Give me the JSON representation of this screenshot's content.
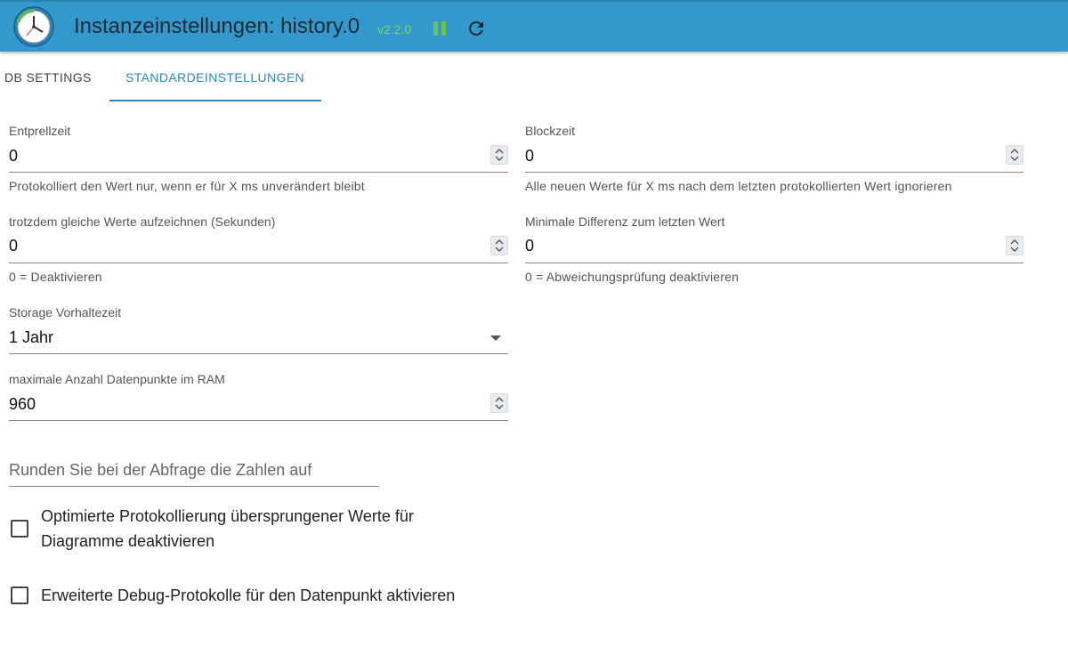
{
  "header": {
    "title": "Instanzeinstellungen: history.0",
    "version": "v2.2.0",
    "logo_icon": "history-clock-icon",
    "pause_icon": "pause-icon",
    "refresh_icon": "refresh-icon",
    "bg_color": "#3399cc"
  },
  "tabs": [
    {
      "label": "DB SETTINGS",
      "active": false
    },
    {
      "label": "STANDARDEINSTELLUNGEN",
      "active": true
    }
  ],
  "fields": {
    "entprellzeit": {
      "label": "Entprellzeit",
      "value": "0",
      "helper": "Protokolliert den Wert nur, wenn er für X ms unverändert bleibt"
    },
    "blockzeit": {
      "label": "Blockzeit",
      "value": "0",
      "helper": "Alle neuen Werte für X ms nach dem letzten protokollierten Wert ignorieren"
    },
    "gleiche_werte": {
      "label": "trotzdem gleiche Werte aufzeichnen (Sekunden)",
      "value": "0",
      "helper": "0 = Deaktivieren"
    },
    "min_differenz": {
      "label": "Minimale Differenz zum letzten Wert",
      "value": "0",
      "helper": "0 = Abweichungsprüfung deaktivieren"
    },
    "storage": {
      "label": "Storage Vorhaltezeit",
      "value": "1 Jahr"
    },
    "max_datenpunkte": {
      "label": "maximale Anzahl Datenpunkte im RAM",
      "value": "960"
    },
    "runden": {
      "placeholder": "Runden Sie bei der Abfrage die Zahlen auf"
    }
  },
  "checkboxes": {
    "optimierte": {
      "label_line1": "Optimierte Protokollierung übersprungener Werte für",
      "label_line2": "Diagramme deaktivieren",
      "checked": false
    },
    "debug": {
      "label": "Erweiterte Debug-Protokolle für den Datenpunkt aktivieren",
      "checked": false
    }
  }
}
